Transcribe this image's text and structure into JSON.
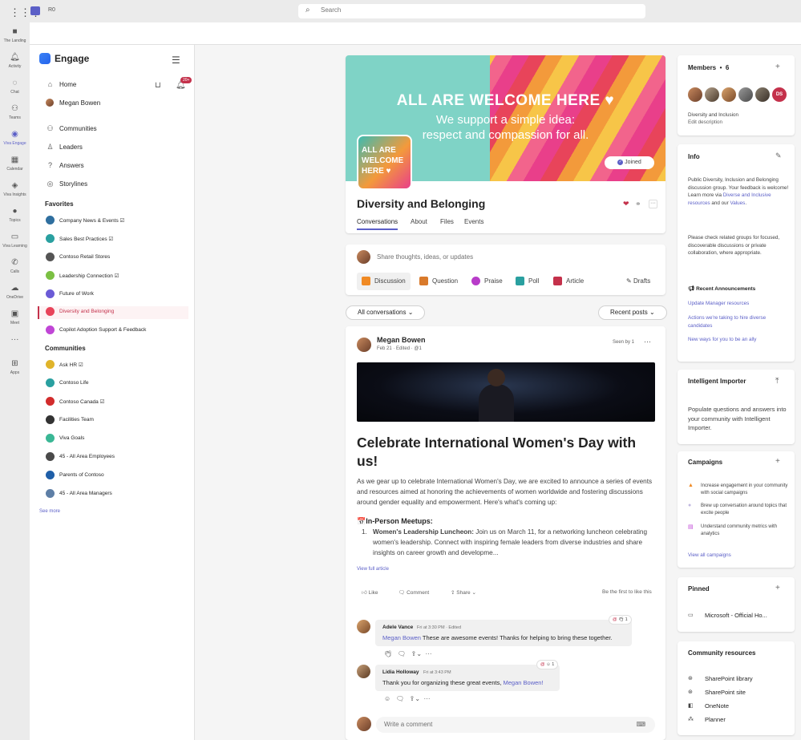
{
  "topbar": {
    "tenant": "R0",
    "search_placeholder": "Search"
  },
  "rail": [
    {
      "label": "The Landing",
      "icon": "landing-icon"
    },
    {
      "label": "Activity",
      "icon": "bell-icon"
    },
    {
      "label": "Chat",
      "icon": "chat-icon"
    },
    {
      "label": "Teams",
      "icon": "teams-icon"
    },
    {
      "label": "Viva Engage",
      "icon": "engage-icon"
    },
    {
      "label": "Calendar",
      "icon": "calendar-icon"
    },
    {
      "label": "Viva Insights",
      "icon": "insights-icon"
    },
    {
      "label": "Topics",
      "icon": "topics-icon"
    },
    {
      "label": "Viva Learning",
      "icon": "learning-icon"
    },
    {
      "label": "Calls",
      "icon": "phone-icon"
    },
    {
      "label": "OneDrive",
      "icon": "cloud-icon"
    },
    {
      "label": "Meet",
      "icon": "video-icon"
    },
    {
      "label": "",
      "icon": "more-icon"
    },
    {
      "label": "Apps",
      "icon": "plus-square-icon"
    }
  ],
  "leftnav": {
    "brand": "Engage",
    "notifications_badge": "20+",
    "primary": [
      {
        "label": "Home"
      },
      {
        "label": "Megan Bowen"
      },
      {
        "label": "Communities"
      },
      {
        "label": "Leaders"
      },
      {
        "label": "Answers"
      },
      {
        "label": "Storylines"
      }
    ],
    "favorites_title": "Favorites",
    "favorites": [
      {
        "label": "Company News & Events",
        "verified": "☑"
      },
      {
        "label": "Sales Best Practices",
        "verified": "☑"
      },
      {
        "label": "Contoso Retail Stores",
        "verified": ""
      },
      {
        "label": "Leadership Connection",
        "verified": "☑"
      },
      {
        "label": "Future of Work",
        "verified": ""
      },
      {
        "label": "Diversity and Belonging",
        "verified": ""
      },
      {
        "label": "Copilot Adoption Support & Feedback",
        "verified": ""
      }
    ],
    "communities_title": "Communities",
    "communities": [
      {
        "label": "Ask HR",
        "verified": "☑"
      },
      {
        "label": "Contoso Life",
        "verified": ""
      },
      {
        "label": "Contoso Canada",
        "verified": "☑"
      },
      {
        "label": "Facilities Team",
        "verified": ""
      },
      {
        "label": "Viva Goals",
        "verified": ""
      },
      {
        "label": "45 - All Area Employees",
        "verified": ""
      },
      {
        "label": "Parents of Contoso",
        "verified": ""
      },
      {
        "label": "45 - All Area Managers",
        "verified": ""
      }
    ],
    "see_more": "See more"
  },
  "group": {
    "banner_line1": "ALL ARE WELCOME HERE ♥",
    "banner_line2": "We support a simple idea:",
    "banner_line3": "respect and compassion for all.",
    "logo_line1": "ALL ARE",
    "logo_line2": "WELCOME",
    "logo_line3": "HERE ♥",
    "joined": "Joined",
    "name": "Diversity and Belonging",
    "tabs": [
      "Conversations",
      "About",
      "Files",
      "Events"
    ]
  },
  "composer": {
    "placeholder": "Share thoughts, ideas, or updates",
    "buttons": [
      "Discussion",
      "Question",
      "Praise",
      "Poll",
      "Article"
    ],
    "drafts": "Drafts"
  },
  "filters": {
    "left": "All conversations",
    "right": "Recent posts"
  },
  "post": {
    "author": "Megan Bowen",
    "meta": "Feb 21  ·  Edited  ·  @1",
    "seen_by": "Seen by 1",
    "title": "Celebrate International Women's Day with us!",
    "body": "As we gear up to celebrate International Women's Day, we are excited to announce a series of events and resources aimed at honoring the achievements of women worldwide and fostering discussions around gender equality and empowerment. Here's what's coming up:",
    "section_heading": "📅In-Person Meetups:",
    "item_number": "1.",
    "item_bold": "Women's Leadership Luncheon:",
    "item_text": " Join us on March 11, for a networking luncheon celebrating women's leadership. Connect with inspiring female leaders from diverse industries and share insights on career growth and developme...",
    "view_full": "View full article",
    "like": "Like",
    "comment": "Comment",
    "share": "Share",
    "first_like": "Be the first to like this",
    "comments": [
      {
        "name": "Adele Vance",
        "time": "Fri at 3:30 PM  ·  Edited",
        "mention": "Megan Bowen",
        "text": " These are awesome events! Thanks for helping to bring these together.",
        "reaction_count": "1"
      },
      {
        "name": "Lidia Holloway",
        "time": "Fri at 3:43 PM",
        "mention_prefix": "Thank you for organizing these great events, ",
        "mention": "Megan Bowen!",
        "reaction_count": "1"
      }
    ],
    "write_comment": "Write a comment"
  },
  "right": {
    "members_title": "Members",
    "members_count": "6",
    "members_initials": "DS",
    "group_label": "Diversity and Inclusion",
    "edit_description": "Edit description",
    "info_title": "Info",
    "info_text": "Public Diversity, Inclusion and Belonging discussion group. Your feedback is welcome! Learn more via",
    "info_link1": "Diverse and Inclusive resources",
    "info_and": " and our",
    "info_link2": "Values",
    "info_text2": "Please check related groups for focused, discoverable discussions or private collaboration, where appropriate.",
    "announcements_title": "Recent Announcements",
    "announcements": [
      "Update Manager resources",
      "Actions we're taking to hire diverse candidates",
      "New ways for you to be an ally"
    ],
    "importer_title": "Intelligent Importer",
    "importer_text": "Populate questions and answers into your community with Intelligent Importer.",
    "campaigns_title": "Campaigns",
    "campaigns": [
      "Increase engagement in your community with social campaigns",
      "Brew up conversation around topics that excite people",
      "Understand community metrics with analytics"
    ],
    "view_all_campaigns": "View all campaigns",
    "pinned_title": "Pinned",
    "pinned_item": "Microsoft - Official Ho...",
    "resources_title": "Community resources",
    "resources": [
      "SharePoint library",
      "SharePoint site",
      "OneNote",
      "Planner"
    ]
  }
}
